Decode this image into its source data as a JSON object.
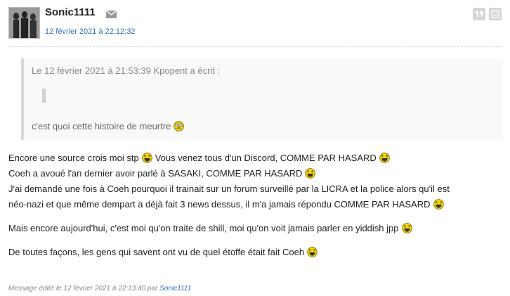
{
  "post": {
    "username": "Sonic1111",
    "date": "12 février 2021 à 22:12:32"
  },
  "quote": {
    "header": "Le 12 février 2021 à 21:53:39 Kpopent a écrit :",
    "text": "c'est quoi cette histoire de meurtre"
  },
  "body": {
    "line1_a": "Encore une source crois moi stp",
    "line1_b": "Vous venez tous d'un Discord, COMME PAR HASARD",
    "line2": "Coeh a avoué l'an dernier avoir parlé à SASAKI, COMME PAR HASARD",
    "line3": "J'ai demandé une fois à Coeh pourquoi il trainait sur un forum surveillé par la LICRA et la police alors qu'il est",
    "line4": "néo-nazi et que même dempart a déjà fait 3 news dessus, il m'a jamais répondu COMME PAR HASARD",
    "para2": "Mais encore aujourd'hui, c'est moi qu'on traite de shill, moi qu'on voit jamais parler en yiddish jpp",
    "para3": "De toutes façons, les gens qui savent ont vu de quel étoffe était fait Coeh"
  },
  "footer": {
    "prefix": "Message édité le 12 février 2021 à 22:13:40 par",
    "editor": "Sonic1111"
  },
  "icons": {
    "mail": "envelope-icon",
    "quote_action": "quote-icon",
    "report_action": "report-icon",
    "smiley_laugh": "laughing-smiley-icon",
    "smiley_confused": "dizzy-smiley-icon"
  },
  "colors": {
    "link": "#2f6fb5",
    "muted": "#888888",
    "smiley": "#f5d300"
  }
}
